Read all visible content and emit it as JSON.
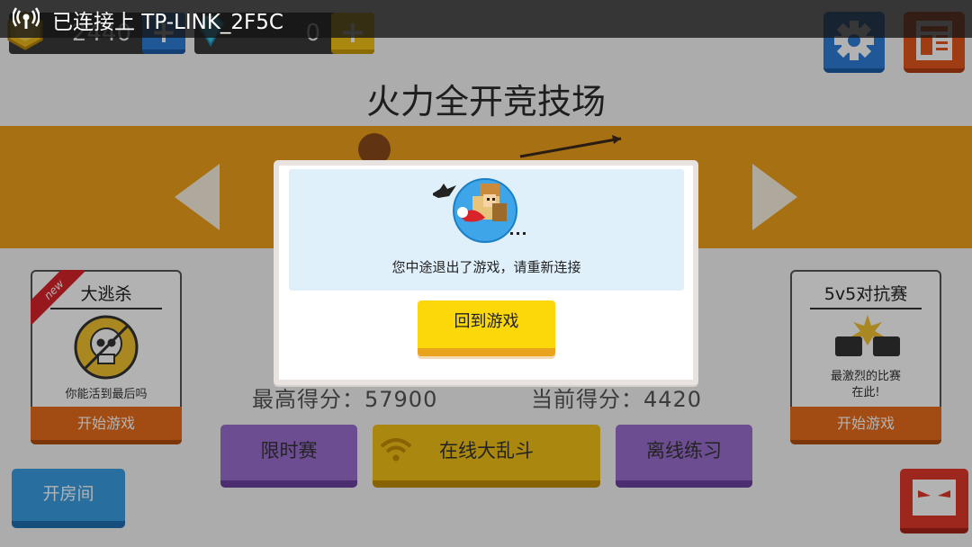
{
  "status_bar": {
    "connection_text": "已连接上 TP-LINK_2F5C",
    "icon": "wifi-hotspot-icon"
  },
  "top_bar": {
    "coins": {
      "amount": "2440",
      "plus": "+",
      "icon": "gold-coin-icon"
    },
    "gems": {
      "amount": "0",
      "plus": "+",
      "icon": "diamond-icon"
    },
    "settings_icon": "gear-icon",
    "news_icon": "newspaper-icon"
  },
  "arena_title": "火力全开竞技场",
  "modes": {
    "battle_royale": {
      "tag": "new",
      "title": "大逃杀",
      "description": "你能活到最后吗",
      "start_label": "开始游戏",
      "icon": "skull-arrow-icon"
    },
    "team_5v5": {
      "title": "5v5对抗赛",
      "description": "最激烈的比赛\n在此!",
      "start_label": "开始游戏",
      "icon": "fist-bump-icon"
    }
  },
  "scores": {
    "best": "最高得分：57900",
    "current": "当前得分：4420"
  },
  "buttons": {
    "limited": "限时赛",
    "online": "在线大乱斗",
    "offline": "离线练习",
    "room": "开房间",
    "online_icon": "wifi-icon",
    "rank_icon": "angry-face-icon"
  },
  "dialog": {
    "message": "您中途退出了游戏，请重新连接",
    "return_label": "回到游戏",
    "illustration": "pixel-character-bats-illustration"
  },
  "colors": {
    "banner": "#f0a21c",
    "start_button": "#e86e1c",
    "purple_button": "#9b6fd0",
    "yellow_button": "#f4c215",
    "blue_button": "#2f7fd8",
    "dialog_panel": "#dff0fb",
    "return_button": "#fcd80b"
  }
}
